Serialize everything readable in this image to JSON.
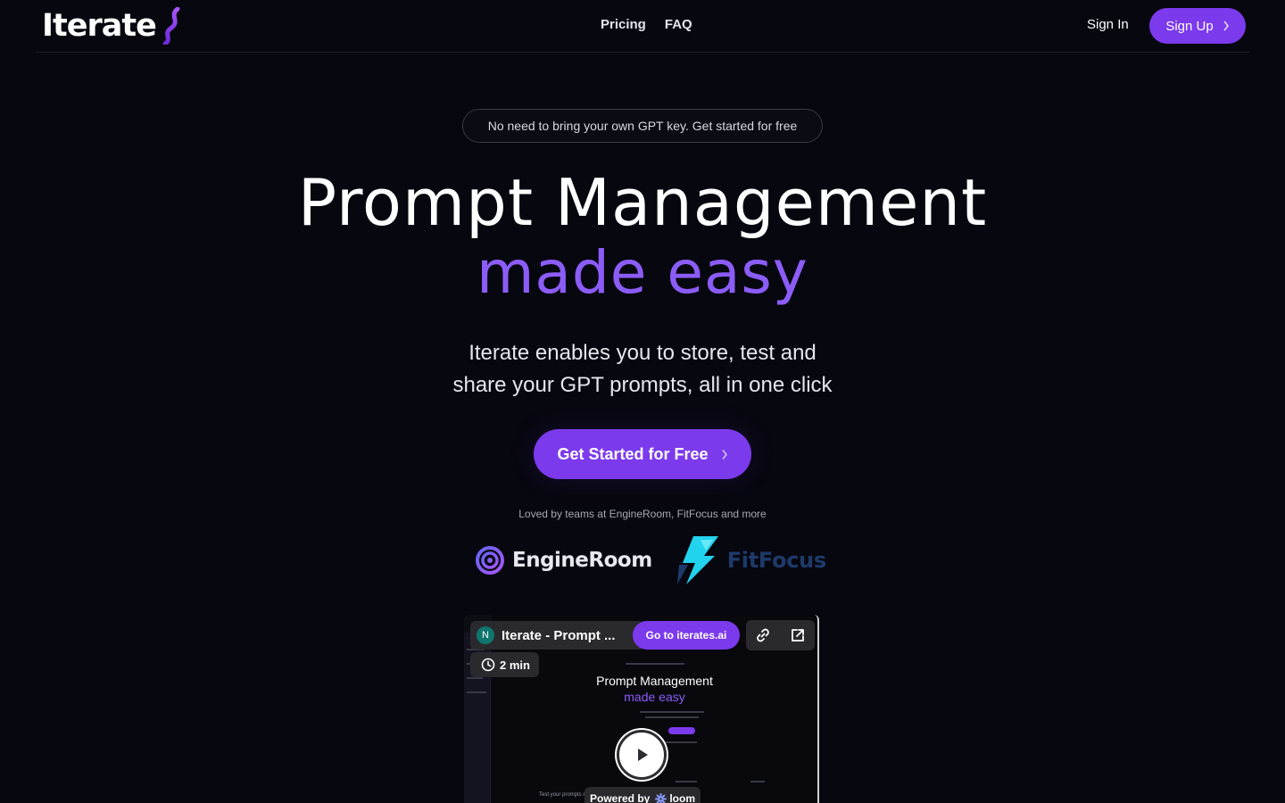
{
  "nav": {
    "logo_text": "Iterate",
    "links": [
      "Pricing",
      "FAQ"
    ],
    "sign_in": "Sign In",
    "sign_up": "Sign Up"
  },
  "hero": {
    "badge": "No need to bring your own GPT key. Get started for free",
    "title": "Prompt Management",
    "title_accent": "made easy",
    "subtitle_line1": "Iterate enables you to store, test and",
    "subtitle_line2": "share your GPT prompts, all in one click",
    "cta": "Get Started for Free",
    "loved_by": "Loved by teams at EngineRoom, FitFocus and more"
  },
  "customers": {
    "engineroom": "EngineRoom",
    "fitfocus": "FitFocus"
  },
  "video": {
    "avatar_initial": "N",
    "title": "Iterate - Prompt ...",
    "goto_label": "Go to iterates.ai",
    "duration": "2 min",
    "powered_by": "Powered by",
    "loom": "loom",
    "preview_title": "Prompt Management",
    "preview_accent": "made easy",
    "preview_footer": "Test your prompts m"
  },
  "colors": {
    "accent": "#7c3aed",
    "background": "#07070f"
  }
}
